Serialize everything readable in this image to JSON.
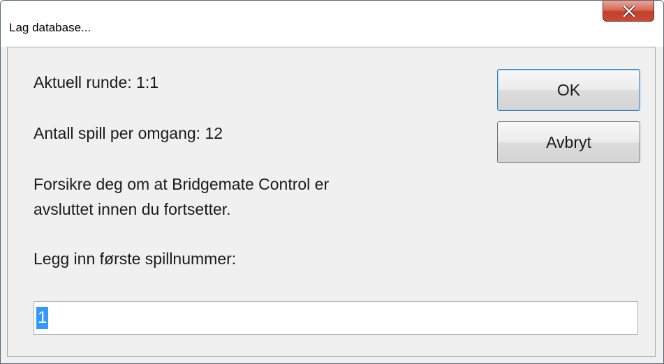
{
  "window": {
    "title": "Lag database..."
  },
  "dialog": {
    "current_round": "Aktuell runde: 1:1",
    "boards_per_round": "Antall spill per omgang: 12",
    "warning_line1": "Forsikre deg om at Bridgemate Control er",
    "warning_line2": "avsluttet innen du fortsetter.",
    "prompt": "Legg inn første spillnummer:",
    "first_board_value": "1"
  },
  "buttons": {
    "ok": "OK",
    "cancel": "Avbryt"
  },
  "colors": {
    "close_button": "#c94a36",
    "selection": "#3399ff",
    "dialog_background": "#f0f0f0"
  },
  "icons": {
    "close": "close-icon"
  }
}
